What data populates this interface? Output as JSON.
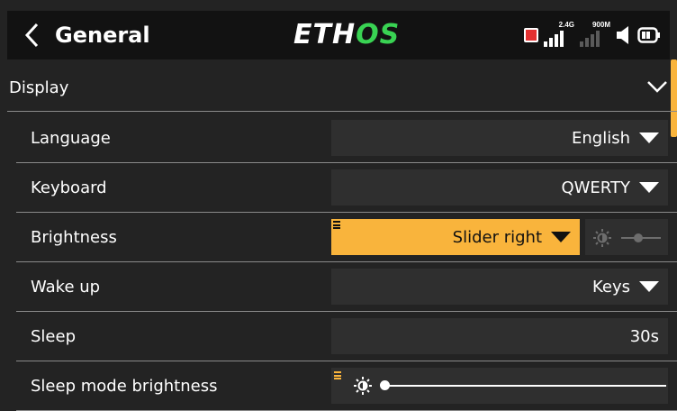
{
  "header": {
    "title": "General",
    "logo_part1": "ETH",
    "logo_part2": "OS",
    "signal_2g4_label": "2.4G",
    "signal_900m_label": "900M",
    "icons": [
      "back-chevron-icon",
      "recording-indicator-icon",
      "signal-bars-icon",
      "speaker-icon",
      "battery-icon"
    ]
  },
  "section": {
    "label": "Display",
    "icon": "chevron-down-icon"
  },
  "rows": [
    {
      "label": "Language",
      "value": "English"
    },
    {
      "label": "Keyboard",
      "value": "QWERTY"
    },
    {
      "label": "Brightness",
      "value": "Slider right"
    },
    {
      "label": "Wake up",
      "value": "Keys"
    },
    {
      "label": "Sleep",
      "value": "30s"
    },
    {
      "label": "Sleep mode brightness",
      "value": ""
    }
  ],
  "colors": {
    "background": "#232323",
    "header": "#121212",
    "field": "#2f2f2f",
    "accent": "#f9b43c",
    "logo_accent": "#39d353",
    "record": "#e23030"
  },
  "sleep_mode_brightness_level": 0.0
}
